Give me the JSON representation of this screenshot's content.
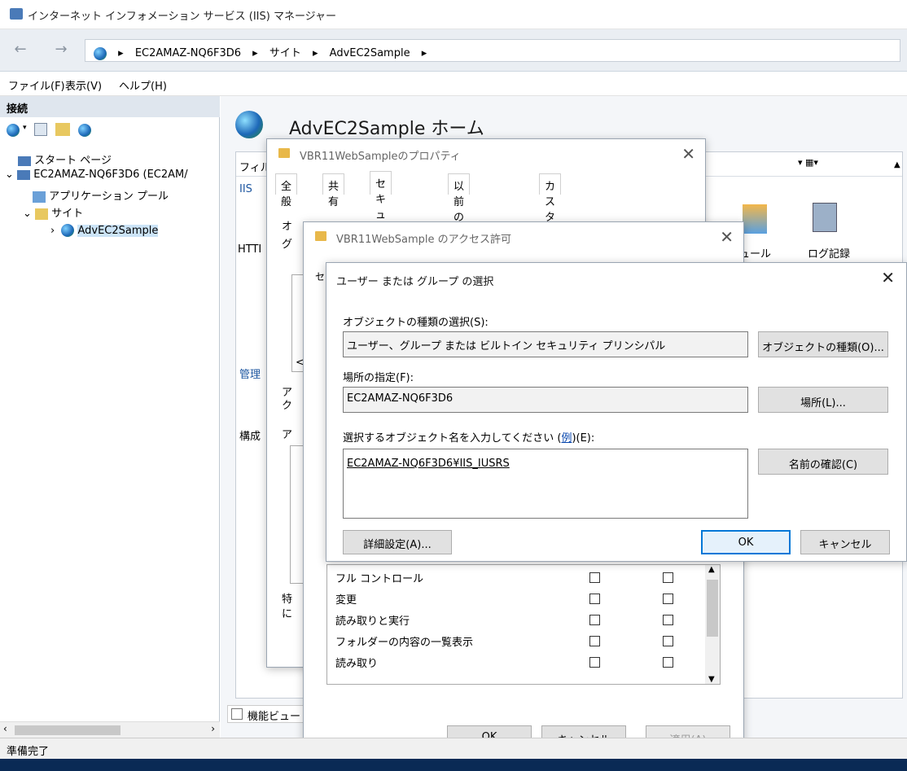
{
  "window": {
    "title": "インターネット インフォメーション サービス (IIS) マネージャー"
  },
  "address": {
    "crumbs": [
      "EC2AMAZ-NQ6F3D6",
      "サイト",
      "AdvEC2Sample"
    ]
  },
  "menu": {
    "items": [
      "ファイル(F)",
      "表示(V)",
      "ヘルプ(H)"
    ]
  },
  "connections": {
    "header": "接続",
    "tree": [
      {
        "label": "スタート ページ"
      },
      {
        "label": "EC2AMAZ-NQ6F3D6 (EC2AM/"
      },
      {
        "label": "アプリケーション プール"
      },
      {
        "label": "サイト"
      },
      {
        "label": "AdvEC2Sample"
      }
    ]
  },
  "status": {
    "text": "準備完了"
  },
  "main": {
    "title": "AdvEC2Sample ホーム",
    "features": [
      "モジュール",
      "ログ記録"
    ],
    "partials": [
      "フィル",
      "IIS",
      "HTTI",
      "管理",
      "構成",
      "機能ビュー"
    ],
    "module_label_visible": "ュール"
  },
  "props_dialog": {
    "title": "VBR11WebSampleのプロパティ",
    "tabs": [
      "全般",
      "共有",
      "セキュリティ",
      "以前のバージョン",
      "カスタマイズ"
    ],
    "partial_text": [
      "オ",
      "グ",
      "ア",
      "ク",
      "ア",
      "特",
      "に"
    ],
    "scroll_char": "<"
  },
  "perm_dialog": {
    "title": "VBR11WebSample のアクセス許可",
    "partial_tab": "セ",
    "permissions": [
      "フル コントロール",
      "変更",
      "読み取りと実行",
      "フォルダーの内容の一覧表示",
      "読み取り"
    ],
    "ok": "OK",
    "cancel": "キャンセル",
    "apply": "適用(A)"
  },
  "select_dialog": {
    "title": "ユーザー または グループ の選択",
    "object_type_label": "オブジェクトの種類の選択(S):",
    "object_type_value": "ユーザー、グループ または ビルトイン セキュリティ プリンシパル",
    "object_type_button": "オブジェクトの種類(O)...",
    "location_label": "場所の指定(F):",
    "location_value": "EC2AMAZ-NQ6F3D6",
    "location_button": "場所(L)...",
    "names_label_pre": "選択するオブジェクト名を入力してください (",
    "names_label_link": "例",
    "names_label_post": ")(E):",
    "names_value": "EC2AMAZ-NQ6F3D6¥IIS_IUSRS",
    "check_names_button": "名前の確認(C)",
    "advanced_button": "詳細設定(A)...",
    "ok": "OK",
    "cancel": "キャンセル"
  }
}
